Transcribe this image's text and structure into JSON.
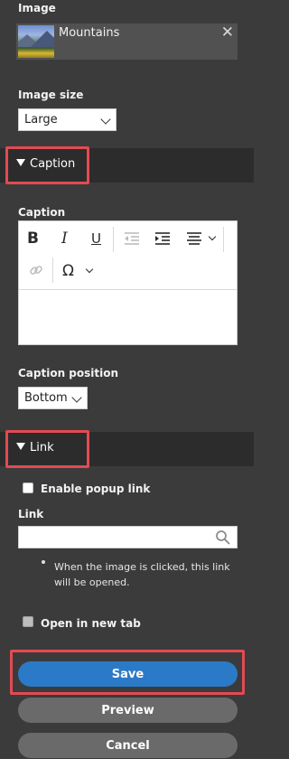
{
  "image": {
    "label": "Image",
    "name": "Mountains",
    "remove": "✕",
    "size_label": "Image size",
    "size_value": "Large"
  },
  "caption_section": {
    "title": "Caption",
    "field_label": "Caption",
    "position_label": "Caption position",
    "position_value": "Bottom",
    "toolbar": {
      "bold": "B",
      "italic": "I",
      "underline": "U",
      "special_char": "Ω"
    }
  },
  "link_section": {
    "title": "Link",
    "popup_label": "Enable popup link",
    "link_label": "Link",
    "link_value": "",
    "hint": "When the image is clicked, this link will be opened.",
    "new_tab_label": "Open in new tab"
  },
  "actions": {
    "save": "Save",
    "preview": "Preview",
    "cancel": "Cancel"
  },
  "colors": {
    "panel_bg": "#3b3b3b",
    "section_bg": "#2c2c2c",
    "highlight": "#e34a52",
    "primary": "#2b7ac8",
    "secondary": "#6a6a6a"
  }
}
